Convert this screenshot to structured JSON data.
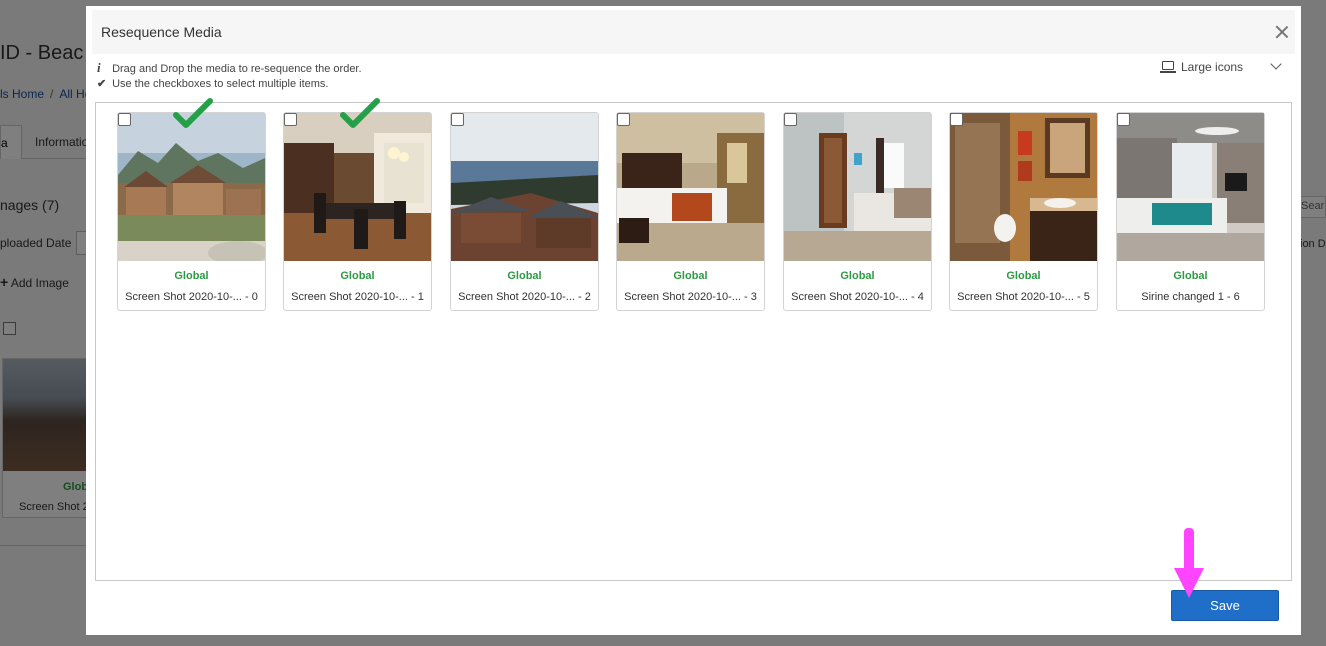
{
  "background": {
    "title": "ID - Beac",
    "breadcrumbs": [
      "ls Home",
      "All Ho"
    ],
    "tabs": [
      "a",
      "Informatio"
    ],
    "images_heading": "nages (7)",
    "uploaded_label": "ploaded Date",
    "add_image": "Add Image",
    "card_scope": "Globa",
    "card_name": "Screen Shot 2",
    "search_placeholder": "Sear",
    "right_text": "ion D"
  },
  "modal": {
    "title": "Resequence Media",
    "hint_drag": "Drag and Drop the media to re-sequence the order.",
    "hint_checkbox": "Use the checkboxes to select multiple items.",
    "view_mode": "Large icons",
    "save_label": "Save",
    "colors": {
      "accent": "#1f6fc9",
      "scope_green": "#2e9a44",
      "annotation": "#ff44ff"
    },
    "media": [
      {
        "scope": "Global",
        "name": "Screen Shot 2020-10-... - 0",
        "checked_annotation": true
      },
      {
        "scope": "Global",
        "name": "Screen Shot 2020-10-... - 1",
        "checked_annotation": true
      },
      {
        "scope": "Global",
        "name": "Screen Shot 2020-10-... - 2",
        "checked_annotation": false
      },
      {
        "scope": "Global",
        "name": "Screen Shot 2020-10-... - 3",
        "checked_annotation": false
      },
      {
        "scope": "Global",
        "name": "Screen Shot 2020-10-... - 4",
        "checked_annotation": false
      },
      {
        "scope": "Global",
        "name": "Screen Shot 2020-10-... - 5",
        "checked_annotation": false
      },
      {
        "scope": "Global",
        "name": "Sirine changed 1 - 6",
        "checked_annotation": false
      }
    ]
  }
}
